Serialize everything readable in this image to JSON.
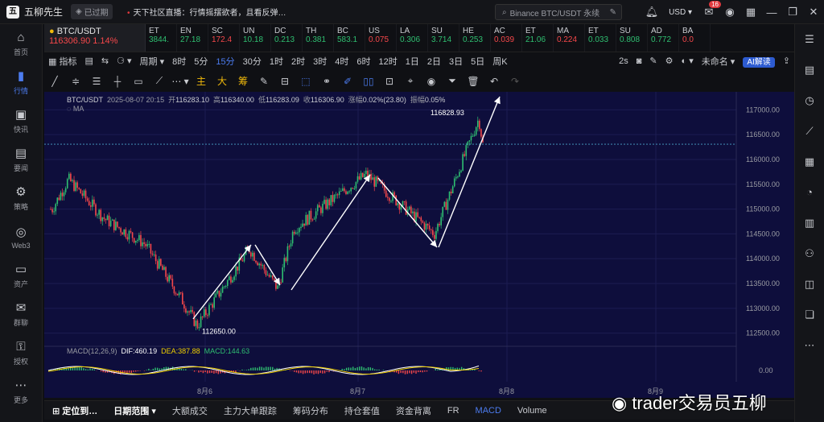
{
  "app": {
    "name": "五柳先生",
    "expired_badge": "已过期",
    "news": "天下社区直播：行情摇摆欲者，且看反弹…",
    "search_placeholder": "Binance BTC/USDT 永续",
    "currency": "USD",
    "notification_count": "16"
  },
  "sidebar": [
    {
      "label": "首页",
      "icon": "home-icon"
    },
    {
      "label": "行情",
      "icon": "market-icon"
    },
    {
      "label": "快讯",
      "icon": "news-icon"
    },
    {
      "label": "要闻",
      "icon": "headline-icon"
    },
    {
      "label": "策略",
      "icon": "strategy-icon"
    },
    {
      "label": "Web3",
      "icon": "web3-icon"
    },
    {
      "label": "资产",
      "icon": "wallet-icon"
    },
    {
      "label": "群聊",
      "icon": "chat-icon"
    },
    {
      "label": "授权",
      "icon": "auth-icon"
    },
    {
      "label": "更多",
      "icon": "more-icon"
    }
  ],
  "watchlist": {
    "main": {
      "symbol": "BTC/USDT",
      "price": "116306.90",
      "change": "1.14%"
    },
    "items": [
      {
        "symbol": "ET",
        "price": "3844.",
        "dir": "up"
      },
      {
        "symbol": "EN",
        "price": "27.18",
        "dir": "up"
      },
      {
        "symbol": "SC",
        "price": "172.4",
        "dir": "dn"
      },
      {
        "symbol": "UN",
        "price": "10.18",
        "dir": "up"
      },
      {
        "symbol": "DC",
        "price": "0.213",
        "dir": "up"
      },
      {
        "symbol": "TH",
        "price": "0.381",
        "dir": "up"
      },
      {
        "symbol": "BC",
        "price": "583.1",
        "dir": "up"
      },
      {
        "symbol": "US",
        "price": "0.075",
        "dir": "dn"
      },
      {
        "symbol": "LA",
        "price": "0.306",
        "dir": "up"
      },
      {
        "symbol": "SU",
        "price": "3.714",
        "dir": "up"
      },
      {
        "symbol": "HE",
        "price": "0.253",
        "dir": "up"
      },
      {
        "symbol": "AC",
        "price": "0.039",
        "dir": "dn"
      },
      {
        "symbol": "ET",
        "price": "21.06",
        "dir": "up"
      },
      {
        "symbol": "MA",
        "price": "0.224",
        "dir": "dn"
      },
      {
        "symbol": "ET",
        "price": "0.033",
        "dir": "up"
      },
      {
        "symbol": "SU",
        "price": "0.808",
        "dir": "up"
      },
      {
        "symbol": "AD",
        "price": "0.772",
        "dir": "up"
      },
      {
        "symbol": "BA",
        "price": "0.0",
        "dir": "dn"
      }
    ]
  },
  "toolbar1": [
    "指标",
    "周期",
    "8时",
    "5分",
    "15分",
    "30分",
    "1时",
    "2时",
    "3时",
    "4时",
    "6时",
    "12时",
    "1日",
    "2日",
    "3日",
    "5日",
    "周K",
    "2s",
    "未命名",
    "AI解读"
  ],
  "toolbar1_selected": "15分",
  "toolbar2": [
    "主",
    "大",
    "筹"
  ],
  "chart": {
    "ohlc": {
      "symbol": "BTC/USDT",
      "datetime": "2025-08-07 20:15",
      "open_label": "开",
      "open": "116283.10",
      "high_label": "高",
      "high": "116340.00",
      "low_label": "低",
      "low": "116283.09",
      "close_label": "收",
      "close": "116306.90",
      "chg_label": "涨幅",
      "chg": "0.02%(23.80)",
      "amp_label": "振幅",
      "amp": "0.05%"
    },
    "ma_label": "MA",
    "high_marker": "116828.93",
    "low_marker": "112650.00",
    "price_ticks": [
      "117000.00",
      "116500.00",
      "116000.00",
      "115500.00",
      "115000.00",
      "114500.00",
      "114000.00",
      "113500.00",
      "113000.00",
      "112500.00"
    ],
    "date_ticks": [
      "8月6",
      "8月7",
      "8月8",
      "8月9"
    ],
    "macd": {
      "label": "MACD(12,26,9)",
      "dif": "DIF:460.19",
      "dea": "DEA:387.88",
      "macd": "MACD:144.63",
      "zero": "0.00"
    }
  },
  "chart_data": {
    "type": "line",
    "title": "BTC/USDT",
    "xlabel": "",
    "ylabel": "",
    "categories": [
      "8月6",
      "8月7",
      "8月8"
    ],
    "ylim": [
      112300,
      117200
    ],
    "series": [
      {
        "values": [
          115000,
          115600,
          114800,
          114300,
          113200,
          112650,
          114200,
          113400,
          114600,
          115700,
          114500,
          116828.93,
          116306.9
        ]
      }
    ],
    "current_price": 116306.9,
    "high": 116828.93,
    "low": 112650.0
  },
  "bottom": [
    "定位到…",
    "日期范围",
    "大额成交",
    "主力大单跟踪",
    "筹码分布",
    "持仓套值",
    "资金背离",
    "FR",
    "MACD",
    "Volume"
  ],
  "bottom_selected": "MACD",
  "watermark": "trader交易员五柳"
}
